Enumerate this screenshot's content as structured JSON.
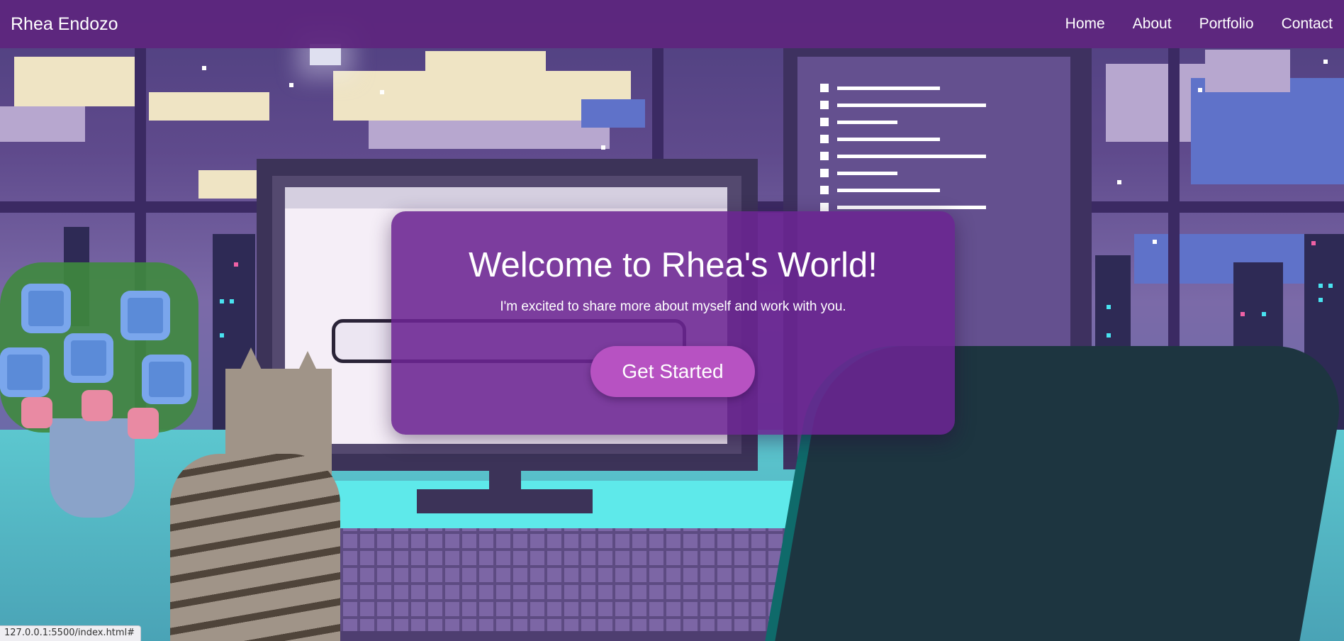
{
  "navbar": {
    "brand": "Rhea Endozo",
    "links": [
      "Home",
      "About",
      "Portfolio",
      "Contact"
    ]
  },
  "hero": {
    "title": "Welcome to Rhea's World!",
    "subtitle": "I'm excited to share more about myself and work with you.",
    "button_label": "Get Started"
  },
  "status_bar": {
    "url": "127.0.0.1:5500/index.html#"
  },
  "colors": {
    "navbar_bg": "#5e267e",
    "hero_bg": "#6b2492",
    "button_bg": "#b752c2",
    "text": "#ffffff"
  }
}
